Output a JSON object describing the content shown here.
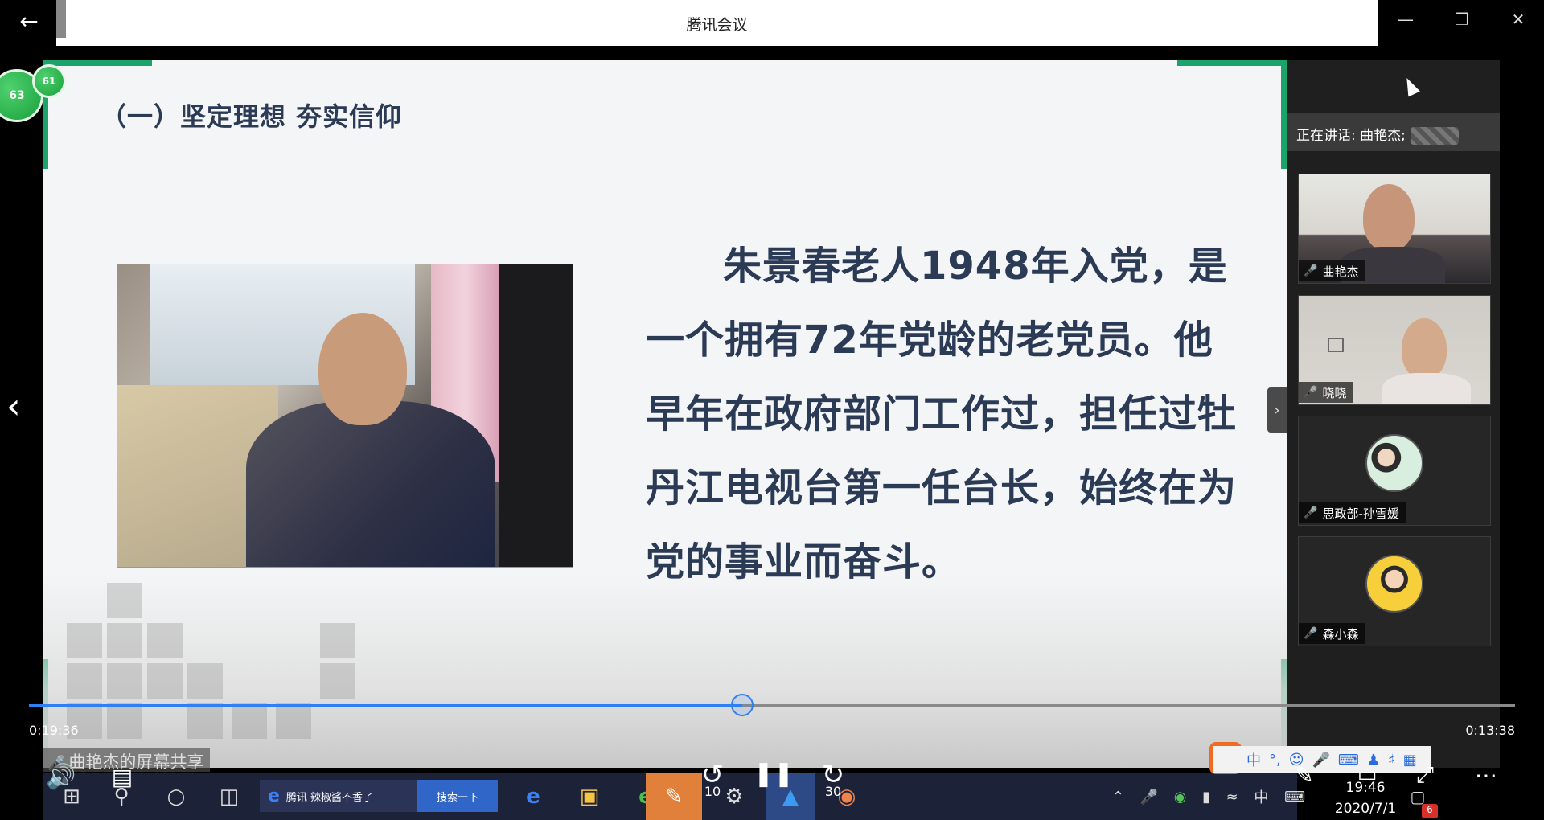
{
  "window": {
    "title": "腾讯会议",
    "controls": [
      "minimize-icon",
      "restore-icon",
      "close-icon"
    ]
  },
  "player": {
    "back_icon": "arrow-left-icon",
    "elapsed": "0:19:36",
    "remaining": "0:13:38",
    "progress": 0.48,
    "share_label": "曲艳杰的屏幕共享",
    "rewind_seconds": "10",
    "forward_seconds": "30"
  },
  "badges": {
    "left": "63",
    "right": "61"
  },
  "slide": {
    "heading": "（一）坚定理想  夯实信仰",
    "body": "朱景春老人1948年入党，是一个拥有72年党龄的老党员。他早年在政府部门工作过，担任过牡丹江电视台第一任台长，始终在为党的事业而奋斗。"
  },
  "sidebar": {
    "speaking_label": "正在讲话: 曲艳杰;",
    "participants": [
      {
        "name": "曲艳杰",
        "mic": "on"
      },
      {
        "name": "晓晓",
        "mic": "off"
      },
      {
        "name": "思政部-孙雪媛",
        "mic": "off"
      },
      {
        "name": "森小森",
        "mic": "off"
      }
    ]
  },
  "taskbar": {
    "search_text": "腾讯 辣椒酱不香了",
    "search_button": "搜索一下",
    "time": "19:46",
    "date": "2020/7/1",
    "notification_count": "6",
    "ime_mode": "中"
  },
  "colors": {
    "slide_accent": "#1aa36b",
    "progress": "#2f7ff5",
    "slide_text": "#2b3a55"
  }
}
